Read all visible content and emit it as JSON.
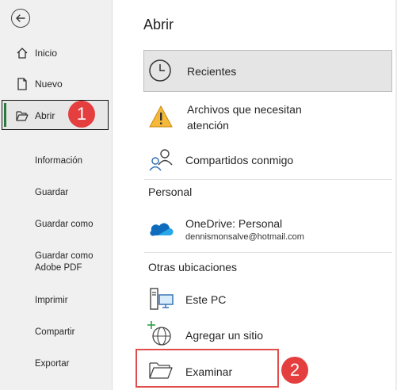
{
  "sidebar": {
    "items": [
      {
        "label": "Inicio",
        "icon": "home-icon"
      },
      {
        "label": "Nuevo",
        "icon": "new-file-icon"
      },
      {
        "label": "Abrir",
        "icon": "open-folder-icon"
      }
    ],
    "sub_items": [
      "Información",
      "Guardar",
      "Guardar como",
      "Guardar como Adobe PDF",
      "Imprimir",
      "Compartir",
      "Exportar"
    ]
  },
  "main": {
    "title": "Abrir",
    "recent_label": "Recientes",
    "attention_label": "Archivos que necesitan atención",
    "shared_label": "Compartidos conmigo",
    "personal_section": "Personal",
    "onedrive": {
      "label": "OneDrive: Personal",
      "email": "dennismonsalve@hotmail.com"
    },
    "other_section": "Otras ubicaciones",
    "this_pc_label": "Este PC",
    "add_site_label": "Agregar un sitio",
    "browse_label": "Examinar"
  },
  "annotations": {
    "step1": "1",
    "step2": "2",
    "highlight_color": "#e34b4b"
  }
}
